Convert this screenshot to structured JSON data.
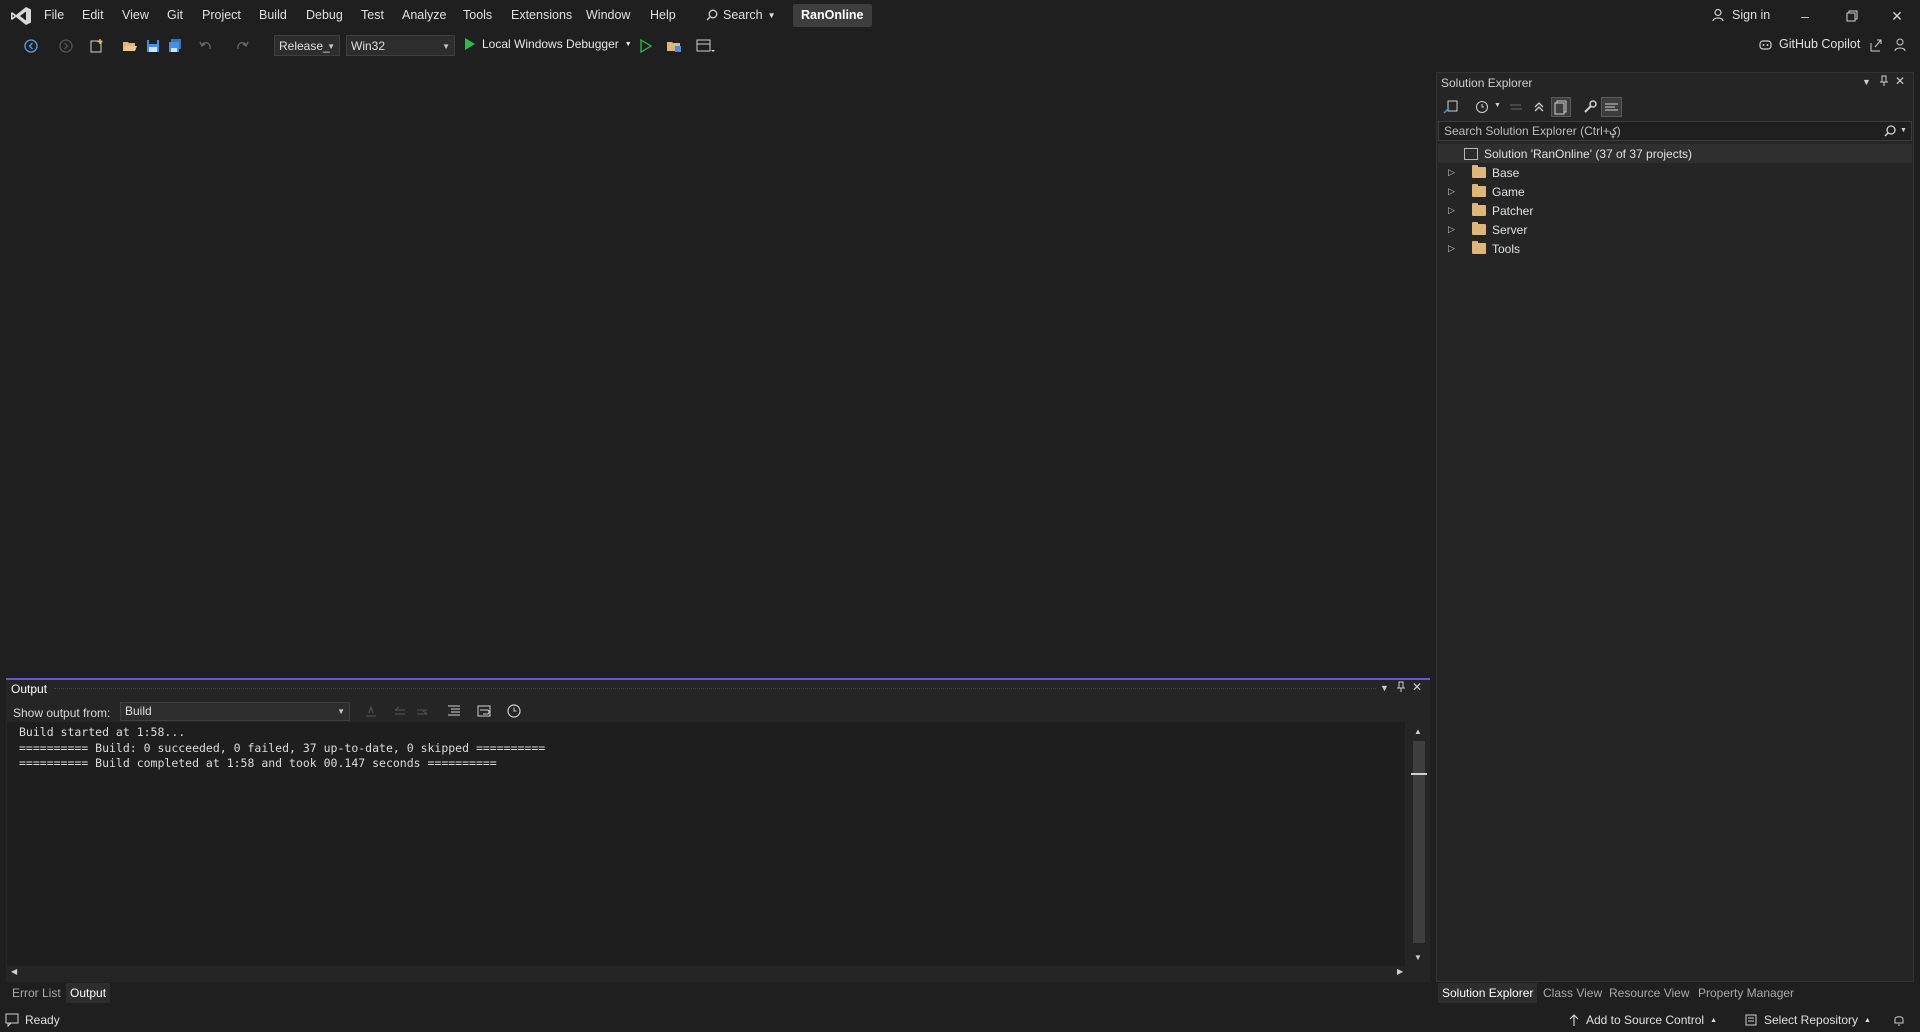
{
  "menu": {
    "items": [
      "File",
      "Edit",
      "View",
      "Git",
      "Project",
      "Build",
      "Debug",
      "Test",
      "Analyze",
      "Tools",
      "Extensions",
      "Window",
      "Help"
    ],
    "search_label": "Search",
    "solution_name": "RanOnline",
    "sign_in": "Sign in"
  },
  "toolbar": {
    "configuration": "Release_",
    "platform": "Win32",
    "debugger": "Local Windows Debugger",
    "copilot": "GitHub Copilot"
  },
  "solution_explorer": {
    "title": "Solution Explorer",
    "search_placeholder": "Search Solution Explorer (Ctrl+ؼ)",
    "solution_label": "Solution 'RanOnline' (37 of 37 projects)",
    "folders": [
      "Base",
      "Game",
      "Patcher",
      "Server",
      "Tools"
    ],
    "tabs": [
      "Solution Explorer",
      "Class View",
      "Resource View",
      "Property Manager"
    ]
  },
  "output": {
    "title": "Output",
    "show_from_label": "Show output from:",
    "source": "Build",
    "lines": [
      "Build started at 1:58...",
      "========== Build: 0 succeeded, 0 failed, 37 up-to-date, 0 skipped ==========",
      "========== Build completed at 1:58 and took 00.147 seconds =========="
    ]
  },
  "panel_tabs": [
    "Error List",
    "Output"
  ],
  "status": {
    "ready": "Ready",
    "add_source_control": "Add to Source Control",
    "select_repository": "Select Repository"
  },
  "colors": {
    "background": "#1f1f1f",
    "accent": "#6e56cf",
    "run_green": "#2fb94f",
    "folder": "#dcb67a"
  }
}
